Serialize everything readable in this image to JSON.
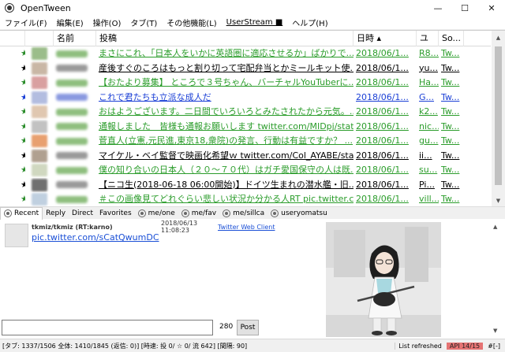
{
  "window": {
    "title": "OpenTween",
    "minimize": "—",
    "maximize": "☐",
    "close": "✕"
  },
  "menu": [
    "ファイル(F)",
    "編集(E)",
    "操作(O)",
    "タブ(T)",
    "その他機能(L)",
    "UserStream ■",
    "ヘルプ(H)"
  ],
  "columns": {
    "name": "名前",
    "post": "投稿",
    "date": "日時 ▴",
    "u": "ユ",
    "src": "So..."
  },
  "rows": [
    {
      "mark": "★",
      "mark_color": "#2a8c2a",
      "post": "まさにこれ、「日本人をいかに英語圏に適応させるか」ばかりで...",
      "date": "2018/06/1...",
      "u": "R8...",
      "src": "Tw...",
      "text_color": "#2a9c2a",
      "avatar": "#9bbd8a",
      "name_color": "#8fbf7f"
    },
    {
      "mark": "★",
      "mark_color": "#000000",
      "post": "産後すぐのころはもっと割り切って宅配弁当とかミールキット使...",
      "date": "2018/06/1...",
      "u": "yu...",
      "src": "Tw...",
      "text_color": "#000000",
      "avatar": "#c9b7a5",
      "name_color": "#9a9a9a"
    },
    {
      "mark": "★",
      "mark_color": "#2a8c2a",
      "post": "【おたより募集】 ところで３号ちゃん、バーチャルYouTuberに...",
      "date": "2018/06/1...",
      "u": "Ha...",
      "src": "Tw...",
      "text_color": "#2a9c2a",
      "avatar": "#d9a0a0",
      "name_color": "#8fbf7f"
    },
    {
      "mark": "★",
      "mark_color": "#1a3fd6",
      "post": "これで君たちも立派な成人だ",
      "date": "2018/06/1...",
      "u": "G...",
      "src": "Tw...",
      "text_color": "#1a3fd6",
      "avatar": "#b3bde0",
      "name_color": "#8a99e0"
    },
    {
      "mark": "★",
      "mark_color": "#2a8c2a",
      "post": "おはようございます。二日間でいろいろとみたされたから元気。...",
      "date": "2018/06/1...",
      "u": "k2...",
      "src": "Tw...",
      "text_color": "#2a9c2a",
      "avatar": "#e0c7b0",
      "name_color": "#8fbf7f"
    },
    {
      "mark": "★",
      "mark_color": "#2a8c2a",
      "post": "通報しました　皆様も通報お願いします twitter.com/MIDpj/stat...",
      "date": "2018/06/1...",
      "u": "nic...",
      "src": "Tw...",
      "text_color": "#2a9c2a",
      "avatar": "#c2c2c2",
      "name_color": "#8fbf7f"
    },
    {
      "mark": "★",
      "mark_color": "#2a8c2a",
      "post": "菅直人(立憲,元民進,東京18,衆院)の発言、行動は有益ですか？ ...",
      "date": "2018/06/1...",
      "u": "gu...",
      "src": "Tw...",
      "text_color": "#2a9c2a",
      "avatar": "#e8a070",
      "name_color": "#8fbf7f"
    },
    {
      "mark": "★",
      "mark_color": "#000000",
      "post": "マイケル・ベイ監督で映画化希望ｗ twitter.com/Col_AYABE/sta",
      "date": "2018/06/1...",
      "u": "ii...",
      "src": "Tw...",
      "text_color": "#000000",
      "avatar": "#b0a090",
      "name_color": "#9a9a9a"
    },
    {
      "mark": "★",
      "mark_color": "#2a8c2a",
      "post": "僕の知り合いの日本人（２０～７０代）はガチ愛国保守の人は既...",
      "date": "2018/06/1...",
      "u": "su...",
      "src": "Tw...",
      "text_color": "#2a9c2a",
      "avatar": "#d0d8c0",
      "name_color": "#8fbf7f"
    },
    {
      "mark": "★",
      "mark_color": "#000000",
      "post": "【ニコ生(2018-06-18 06:00開始)】ドイツ生まれの潜水艦・旧...",
      "date": "2018/06/1...",
      "u": "Pi...",
      "src": "Tw...",
      "text_color": "#000000",
      "avatar": "#707070",
      "name_color": "#9a9a9a"
    },
    {
      "mark": "★",
      "mark_color": "#2a8c2a",
      "post": "＃この画像見てどれぐらい悲しい状況か分かる人RT pic.twitter.c...",
      "date": "2018/06/1...",
      "u": "vill...",
      "src": "Tw...",
      "text_color": "#2a9c2a",
      "avatar": "#c0d0e0",
      "name_color": "#8fbf7f"
    }
  ],
  "tabs": [
    "Recent",
    "Reply",
    "Direct",
    "Favorites",
    "me/one",
    "me/fav",
    "me/sillca",
    "useryomatsu"
  ],
  "detail": {
    "user": "tkmiz/tkmiz (RT:karno)",
    "time": "2018/06/13 11:08:23",
    "client": "Twitter Web Client",
    "link": "pic.twitter.com/sCatQwumDC"
  },
  "input": {
    "count": "280",
    "post_label": "Post"
  },
  "status": {
    "main": "[タブ: 1337/1506 全体: 1410/1845 (返信: 0)] [時速: 投 0/ ☆ 0/ 流 642] [間隔: 90]",
    "refresh": "List refreshed",
    "api": "API 14/15",
    "extra": "#[-]"
  }
}
